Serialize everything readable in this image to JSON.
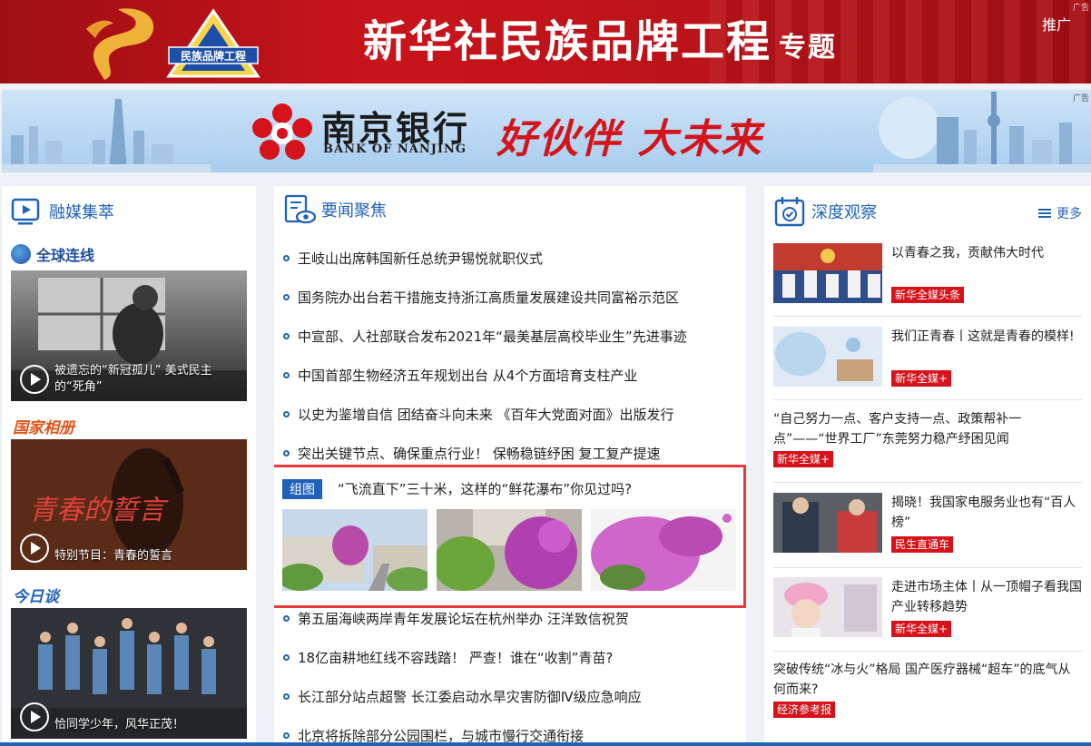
{
  "banner_top": {
    "title": "新华社民族品牌工程",
    "sub": "专题",
    "logo_text": "民族品牌工程",
    "promo": "推广",
    "ad_tag": "广告"
  },
  "banner_bank": {
    "bank_cn": "南京银行",
    "bank_en": "BANK OF NANJING",
    "slogan": "好伙伴 大未来",
    "ad_tag": "广告"
  },
  "left": {
    "section_title": "融媒集萃",
    "sub1": "全球连线",
    "video1": "被遗忘的“新冠孤儿” 美式民主的“死角”",
    "sub2": "国家相册",
    "video2": "特别节目：青春的誓言",
    "video2_art": "青春的誓言",
    "sub3": "今日谈",
    "video3": "恰同学少年，风华正茂！"
  },
  "middle": {
    "section_title": "要闻聚焦",
    "news_top": [
      "王岐山出席韩国新任总统尹锡悦就职仪式",
      "国务院办出台若干措施支持浙江高质量发展建设共同富裕示范区",
      "中宣部、人社部联合发布2021年“最美基层高校毕业生”先进事迹",
      "中国首部生物经济五年规划出台 从4个方面培育支柱产业",
      "以史为鉴增自信 团结奋斗向未来 《百年大党面对面》出版发行",
      "突出关键节点、确保重点行业！ 保畅稳链纾困 复工复产提速"
    ],
    "photo_badge": "组图",
    "photo_title": "“飞流直下”三十米，这样的“鲜花瀑布”你见过吗?",
    "news_bottom": [
      "第五届海峡两岸青年发展论坛在杭州举办 汪洋致信祝贺",
      "18亿亩耕地红线不容践踏！ 严查！谁在“收割”青苗?",
      "长江部分站点超警 长江委启动水旱灾害防御Ⅳ级应急响应",
      "北京将拆除部分公园围栏，与城市慢行交通衔接"
    ]
  },
  "right": {
    "section_title": "深度观察",
    "more": "更多",
    "items": [
      {
        "text": "以青春之我，贡献伟大时代",
        "tag": "新华全媒头条"
      },
      {
        "text": "我们正青春丨这就是青春的模样!",
        "tag": "新华全媒+"
      },
      {
        "text": "“自己努力一点、客户支持一点、政策帮补一点”——“世界工厂”东莞努力稳产纾困见闻",
        "tag": "新华全媒+"
      },
      {
        "text": "揭晓！我国家电服务业也有“百人榜”",
        "tag": "民生直通车"
      },
      {
        "text": "走进市场主体丨从一顶帽子看我国产业转移趋势",
        "tag": "新华全媒+"
      },
      {
        "text": "突破传统“冰与火”格局 国产医疗器械“超车”的底气从何而来?",
        "tag": "经济参考报"
      }
    ]
  },
  "colors": {
    "accent": "#1f63b8",
    "tag_red": "#d6121a",
    "highlight_border": "#e83a3a"
  }
}
